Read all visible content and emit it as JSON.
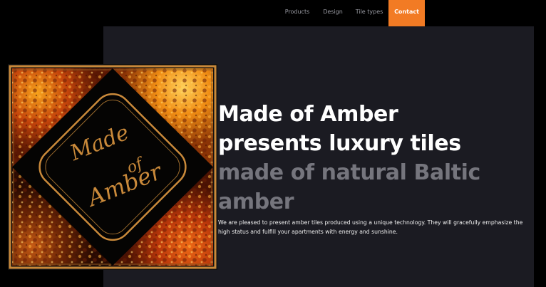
{
  "nav": {
    "items": [
      {
        "label": "Products"
      },
      {
        "label": "Design"
      },
      {
        "label": "Tile types"
      },
      {
        "label": "Contact",
        "active": true
      }
    ]
  },
  "colors": {
    "accent": "#f27b24",
    "panel": "#1b1b22",
    "page_bg": "#000000",
    "muted_text": "#75757d",
    "logo_gold": "#c9893a"
  },
  "hero": {
    "title_line1": "Made of Amber",
    "title_line2": "presents luxury tiles",
    "title_line3": "made of natural Baltic",
    "title_line4": "amber",
    "description": "We are pleased to present amber tiles produced using a unique technology. They will gracefully emphasize the high status and fulfill your apartments with energy and sunshine."
  },
  "logo": {
    "text_line1": "Made",
    "text_line2": "of",
    "text_line3": "Amber"
  }
}
